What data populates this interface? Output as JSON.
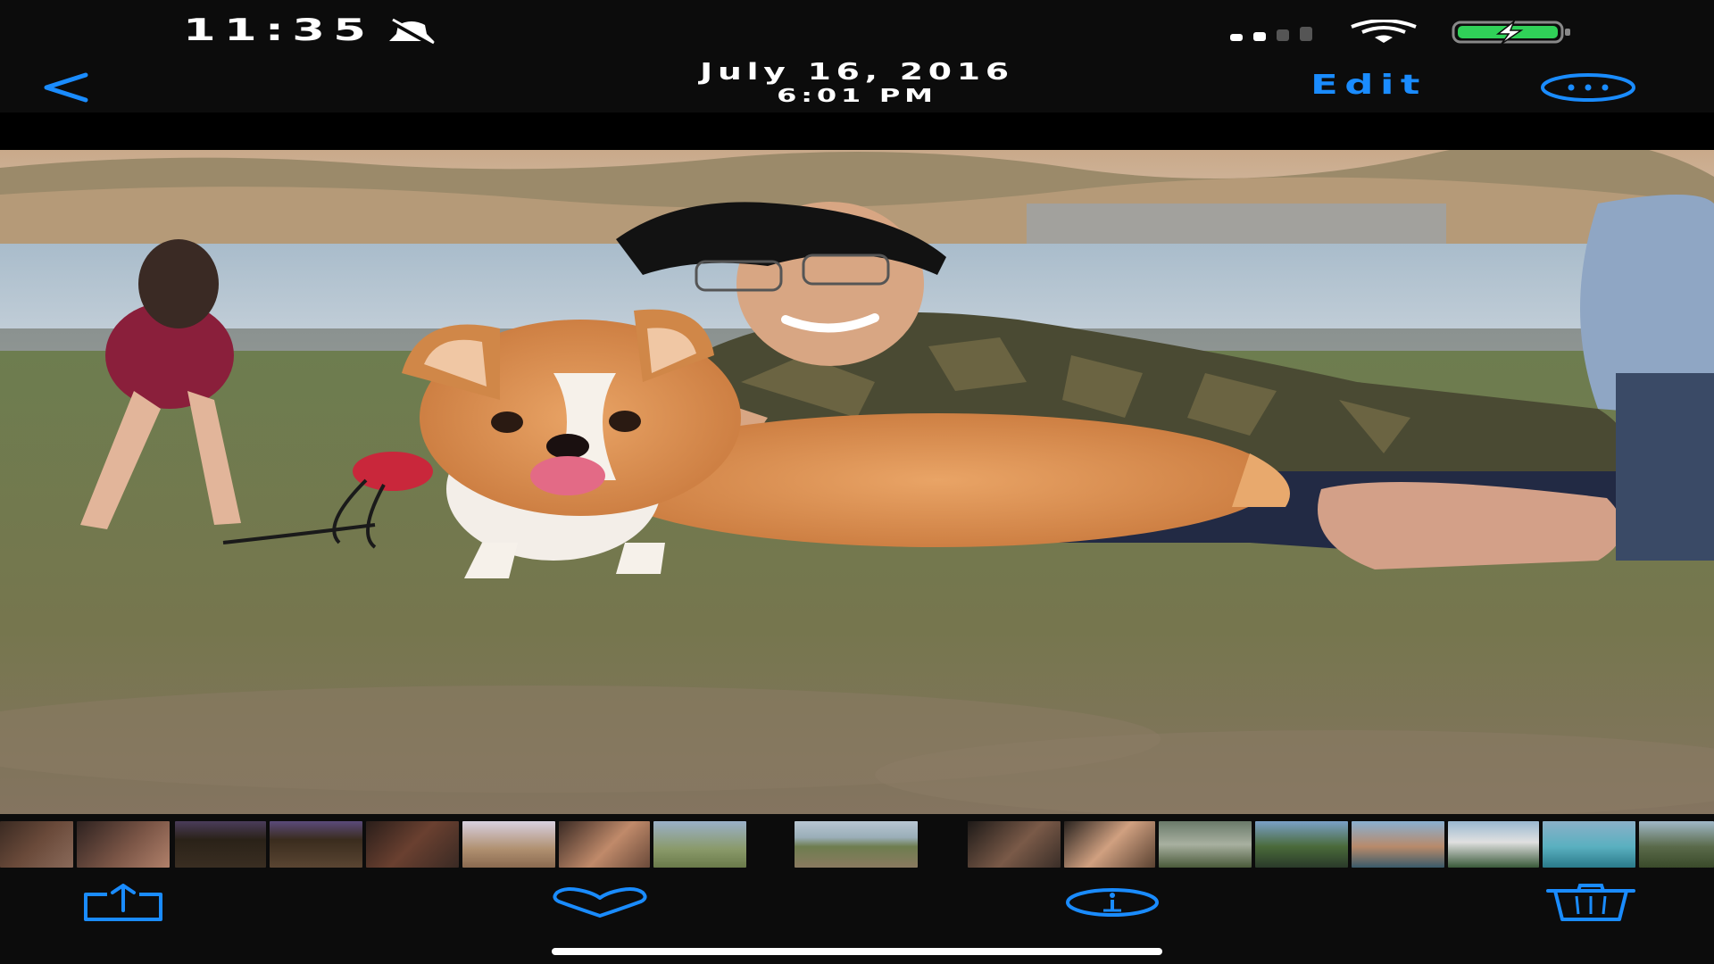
{
  "status_bar": {
    "time": "11:35",
    "silent_icon": "bell-slash-icon",
    "signal_icon": "cellular-signal-icon",
    "wifi_icon": "wifi-icon",
    "battery_icon": "battery-charging-icon",
    "battery_color": "#30d158"
  },
  "nav": {
    "back_icon": "chevron-left-icon",
    "date": "July 16, 2016",
    "time": "6:01 PM",
    "edit_label": "Edit",
    "more_icon": "ellipsis-circle-icon",
    "accent_color": "#1a8cff"
  },
  "photo": {
    "subject": "photo-man-with-corgi"
  },
  "thumbnails": {
    "count": 18
  },
  "toolbar": {
    "share_icon": "share-icon",
    "favorite_icon": "heart-icon",
    "info_icon": "info-circle-icon",
    "delete_icon": "trash-icon"
  }
}
